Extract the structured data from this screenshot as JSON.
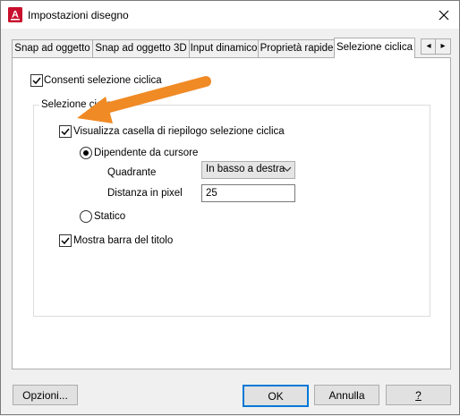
{
  "window": {
    "title": "Impostazioni disegno",
    "app_icon_letter": "A"
  },
  "tabs": [
    {
      "label": "Snap ad oggetto"
    },
    {
      "label": "Snap ad oggetto 3D"
    },
    {
      "label": "Input dinamico"
    },
    {
      "label": "Proprietà rapide"
    },
    {
      "label": "Selezione ciclica",
      "active": true
    }
  ],
  "tab_scroll": {
    "left": "◂",
    "right": "▸"
  },
  "panel": {
    "enable_cycling": {
      "label": "Consenti selezione ciclica",
      "checked": true
    },
    "group": {
      "title": "Selezione ciclica",
      "show_list_box": {
        "label": "Visualizza casella di riepilogo selezione ciclica",
        "checked": true
      },
      "cursor_dependent": {
        "label": "Dipendente da cursore",
        "selected": true
      },
      "quadrant": {
        "label": "Quadrante",
        "value": "In basso a destra"
      },
      "pixel_distance": {
        "label": "Distanza in pixel",
        "value": "25"
      },
      "static": {
        "label": "Statico",
        "selected": false
      },
      "show_title_bar": {
        "label": "Mostra barra del titolo",
        "checked": true
      }
    }
  },
  "buttons": {
    "options": "Opzioni...",
    "ok": "OK",
    "cancel": "Annulla",
    "help": "?"
  },
  "colors": {
    "accent": "#0078d7",
    "arrow": "#f08a24",
    "app_icon": "#c8102e"
  }
}
